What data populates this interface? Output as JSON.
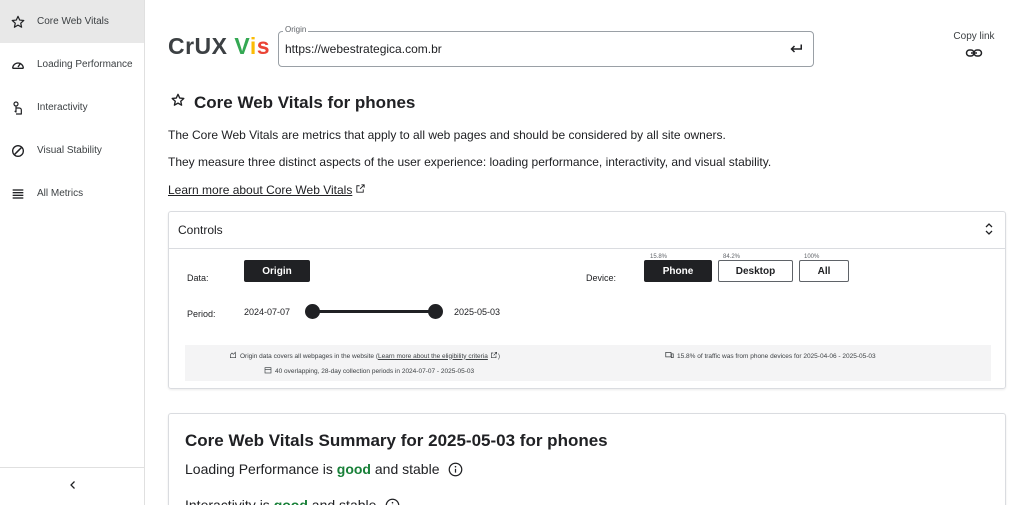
{
  "sidebar": {
    "items": [
      {
        "label": "Core Web Vitals",
        "icon": "star-outline-icon"
      },
      {
        "label": "Loading Performance",
        "icon": "speedometer-icon"
      },
      {
        "label": "Interactivity",
        "icon": "touch-icon"
      },
      {
        "label": "Visual Stability",
        "icon": "stability-icon"
      },
      {
        "label": "All Metrics",
        "icon": "list-icon"
      }
    ],
    "collapse_icon": "chevron-left-icon"
  },
  "header": {
    "logo": {
      "part1": "CrUX ",
      "v": "V",
      "i": "i",
      "s": "s"
    },
    "origin_label": "Origin",
    "origin_value": "https://webestrategica.com.br",
    "copy_link_label": "Copy link"
  },
  "section": {
    "title": "Core Web Vitals for phones",
    "paragraph1": "The Core Web Vitals are metrics that apply to all web pages and should be considered by all site owners.",
    "paragraph2": "They measure three distinct aspects of the user experience: loading performance, interactivity, and visual stability.",
    "learn_more": "Learn more about Core Web Vitals"
  },
  "controls": {
    "title": "Controls",
    "data_label": "Data:",
    "data_button": "Origin",
    "device_label": "Device:",
    "devices": [
      {
        "label": "Phone",
        "pct": "15.8%",
        "selected": true
      },
      {
        "label": "Desktop",
        "pct": "84.2%",
        "selected": false
      },
      {
        "label": "All",
        "pct": "100%",
        "selected": false
      }
    ],
    "period_label": "Period:",
    "period_start": "2024-07-07",
    "period_end": "2025-05-03",
    "info1_text": "Origin data covers all webpages in the website (",
    "info1_link": "Learn more about the eligibility criteria",
    "info1_end": ")",
    "info2": "40 overlapping, 28-day collection periods in 2024-07-07 - 2025-05-03",
    "info3": "15.8% of traffic was from phone devices for 2025-04-06 - 2025-05-03"
  },
  "summary": {
    "title": "Core Web Vitals Summary for 2025-05-03 for phones",
    "rows": [
      {
        "prefix": "Loading Performance is ",
        "status": "good",
        "suffix": " and stable"
      },
      {
        "prefix": "Interactivity is ",
        "status": "good",
        "suffix": " and stable"
      }
    ]
  },
  "colors": {
    "good": "#188038",
    "dark": "#202124",
    "logo_v": "#34a853",
    "logo_i": "#fbbc05",
    "logo_s": "#ea4335"
  }
}
